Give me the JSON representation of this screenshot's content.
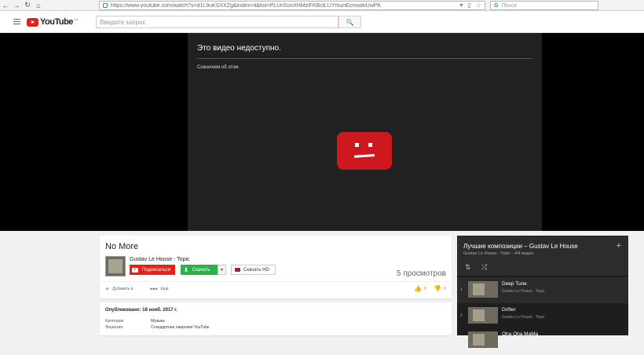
{
  "browser": {
    "url": "https://www.youtube.com/watch?v=d1L9uKSXXZg&index=4&list=PLUnSoxXHMzlFKBctLUYmunEcmodoUwPK",
    "search_placeholder": "Поиск"
  },
  "header": {
    "logo_text": "YouTube",
    "logo_country": "UA",
    "search_placeholder": "Введите запрос"
  },
  "player": {
    "error_title": "Это видео недоступно.",
    "error_subtitle": "Сожалеем об этом."
  },
  "video": {
    "title": "No More",
    "channel": "Gustav Le House - Topic",
    "subscribe_label": "Подписаться",
    "download_label": "Скачать",
    "download_hd_label": "Скачать HD",
    "views": "5 просмотров",
    "add_to_label": "Добавить в",
    "more_label": "Ещё",
    "likes": "0",
    "dislikes": "0"
  },
  "description": {
    "published": "Опубликовано: 18 нояб. 2017 г.",
    "category_label": "Категория",
    "category_value": "Музыка",
    "license_label": "Лицензия",
    "license_value": "Стандартная лицензия YouTube"
  },
  "playlist": {
    "title": "Лучшие композиции – Gustav Le House",
    "subtitle": "Gustav Le House - Topic · 4/4 видео",
    "items": [
      {
        "index": "1",
        "title": "Deep Tune",
        "channel": "Gustav Le House - Topic"
      },
      {
        "index": "2",
        "title": "Drifter",
        "channel": "Gustav Le House - Topic"
      },
      {
        "index": "",
        "title": "Oha Oha MaMa",
        "channel": ""
      }
    ]
  },
  "colors": {
    "youtube_red": "#e62117",
    "download_green": "#2bb24c",
    "player_bg": "#212121",
    "playlist_bg": "#1e1e1e"
  }
}
